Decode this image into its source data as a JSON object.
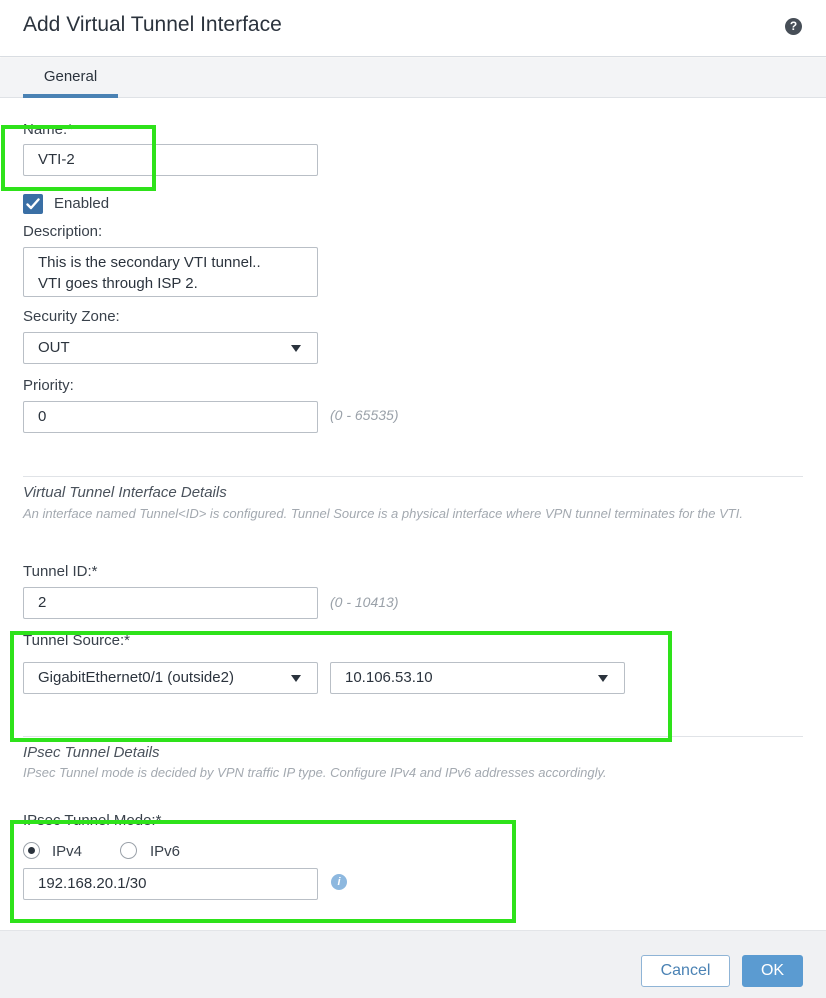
{
  "dialog": {
    "title": "Add Virtual Tunnel Interface",
    "help_icon": "?"
  },
  "tabs": [
    {
      "label": "General",
      "active": true
    }
  ],
  "form": {
    "name": {
      "label": "Name:*",
      "value": "VTI-2"
    },
    "enabled": {
      "label": "Enabled",
      "checked": true
    },
    "description": {
      "label": "Description:",
      "lines": [
        "This is the secondary VTI tunnel..",
        "VTI goes through ISP 2."
      ]
    },
    "security_zone": {
      "label": "Security Zone:",
      "value": "OUT"
    },
    "priority": {
      "label": "Priority:",
      "value": "0",
      "hint": "(0 - 65535)"
    }
  },
  "vti_details": {
    "title": "Virtual Tunnel Interface Details",
    "description": "An interface named Tunnel<ID> is configured. Tunnel Source is a physical interface where VPN tunnel terminates for the VTI.",
    "tunnel_id": {
      "label": "Tunnel ID:*",
      "value": "2",
      "hint": "(0 - 10413)"
    },
    "tunnel_source": {
      "label": "Tunnel Source:*",
      "interface": "GigabitEthernet0/1 (outside2)",
      "ip": "10.106.53.10"
    }
  },
  "ipsec_details": {
    "title": "IPsec Tunnel Details",
    "description": "IPsec Tunnel mode is decided by VPN traffic IP type. Configure IPv4 and IPv6 addresses accordingly.",
    "mode": {
      "label": "IPsec Tunnel Mode:*",
      "options": [
        "IPv4",
        "IPv6"
      ],
      "selected": "IPv4"
    },
    "address": "192.168.20.1/30",
    "info_icon": "i"
  },
  "footer": {
    "cancel_label": "Cancel",
    "ok_label": "OK"
  },
  "colors": {
    "primary": "#5b9bd1",
    "checkbox": "#3a6fa5",
    "highlight": "#2ee21a",
    "tab_underline": "#4a82b4"
  }
}
